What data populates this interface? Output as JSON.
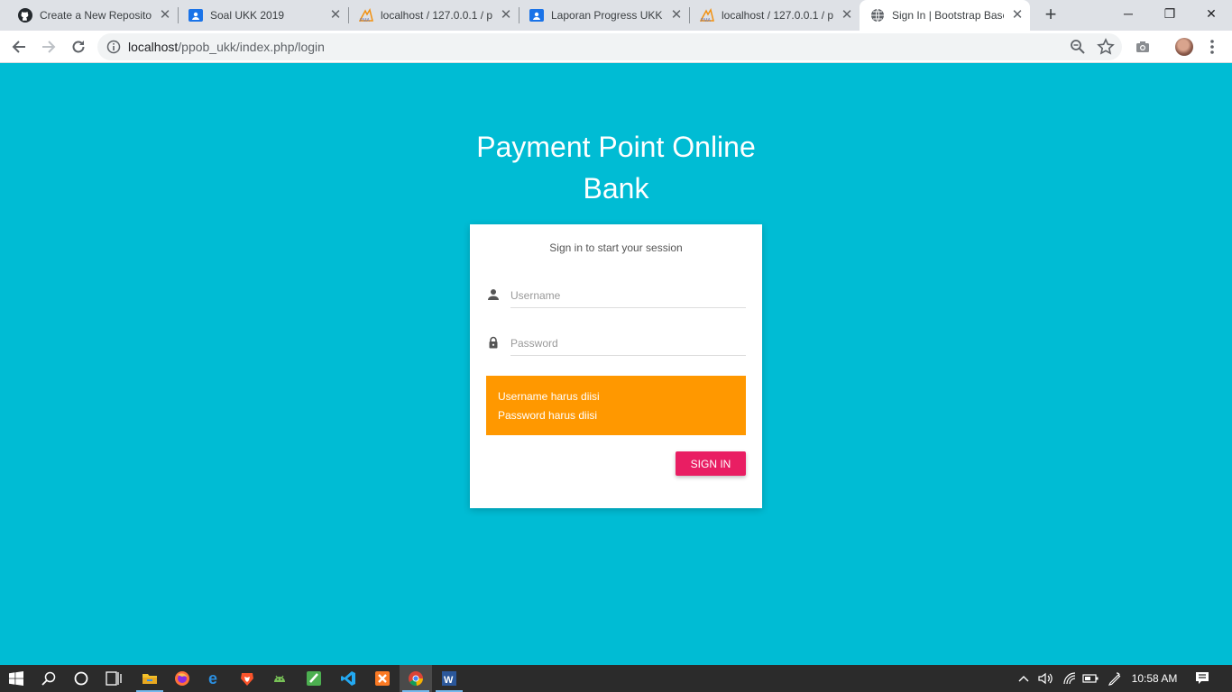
{
  "browser": {
    "tabs": [
      {
        "title": "Create a New Repositor",
        "icon": "github-icon"
      },
      {
        "title": "Soal UKK 2019",
        "icon": "google-classroom-icon"
      },
      {
        "title": "localhost / 127.0.0.1 / p",
        "icon": "phpmyadmin-icon"
      },
      {
        "title": "Laporan Progress UKK T",
        "icon": "google-classroom-icon"
      },
      {
        "title": "localhost / 127.0.0.1 / p",
        "icon": "phpmyadmin-icon"
      },
      {
        "title": "Sign In | Bootstrap Base",
        "icon": "globe-icon",
        "active": true
      }
    ],
    "url_host": "localhost",
    "url_path": "/ppob_ukk/index.php/login"
  },
  "page": {
    "title_line1": "Payment Point Online",
    "title_line2": "Bank",
    "login": {
      "message": "Sign in to start your session",
      "username_placeholder": "Username",
      "password_placeholder": "Password",
      "errors": [
        "Username harus diisi",
        "Password harus diisi"
      ],
      "signin_label": "SIGN IN"
    }
  },
  "taskbar": {
    "apps": [
      "file-explorer-icon",
      "firefox-icon",
      "edge-icon",
      "brave-icon",
      "android-studio-icon",
      "sublime-text-icon",
      "vscode-icon",
      "xampp-icon",
      "chrome-icon",
      "word-icon"
    ],
    "time": "10:58 AM"
  },
  "colors": {
    "page_background": "#00bcd4",
    "alert": "#ff9800",
    "signin_button": "#e91e63"
  }
}
